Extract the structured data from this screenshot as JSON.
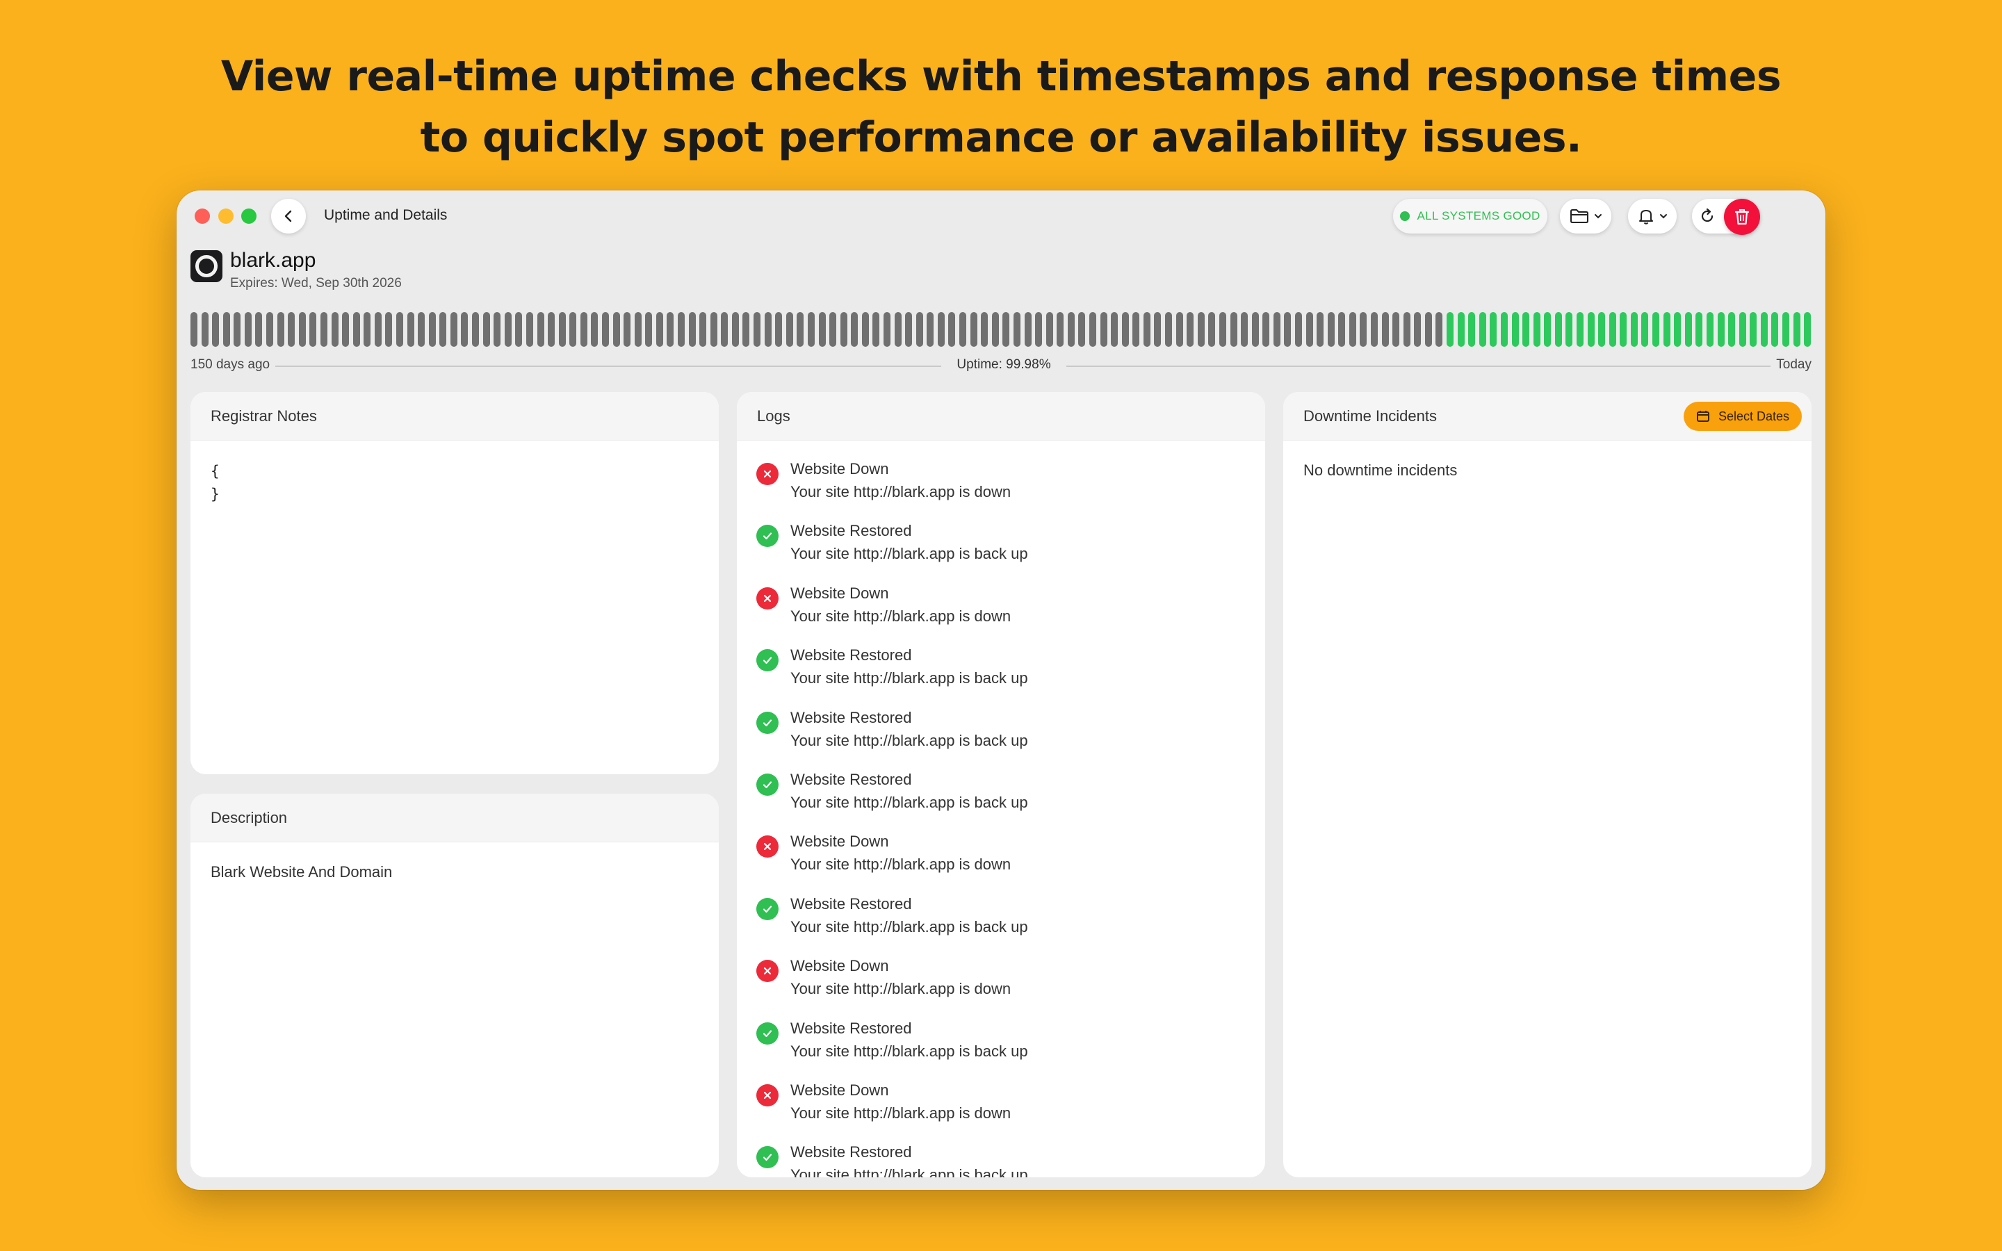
{
  "headline": {
    "line1": "View real-time uptime checks with timestamps and response times",
    "line2": "to quickly spot performance or availability issues."
  },
  "window": {
    "title": "Uptime and Details",
    "status": "ALL SYSTEMS GOOD",
    "colors": {
      "status_green": "#2fbf52",
      "danger_red": "#f3113c",
      "accent_orange": "#f9a10d",
      "bar_down": "#707070",
      "bar_up": "#2ec95c"
    }
  },
  "toolbar": {
    "icons": [
      "chevron-left-icon",
      "folder-icon",
      "bell-icon",
      "refresh-icon",
      "edit-icon",
      "trash-icon"
    ]
  },
  "site": {
    "name": "blark.app",
    "expires": "Expires: Wed, Sep 30th 2026"
  },
  "uptime_bar": {
    "total_bars": 150,
    "green_from_index": 116,
    "left_label": "150 days ago",
    "center_label": "Uptime:  99.98%",
    "right_label": "Today"
  },
  "notes": {
    "title": "Registrar Notes",
    "line1": "{",
    "line2": "}"
  },
  "description": {
    "title": "Description",
    "text": "Blark Website And Domain"
  },
  "logs": {
    "title": "Logs",
    "items": [
      {
        "type": "down",
        "title": "Website Down",
        "message": "Your site http://blark.app is down"
      },
      {
        "type": "up",
        "title": "Website Restored",
        "message": "Your site http://blark.app is back up"
      },
      {
        "type": "down",
        "title": "Website Down",
        "message": "Your site http://blark.app is down"
      },
      {
        "type": "up",
        "title": "Website Restored",
        "message": "Your site http://blark.app is back up"
      },
      {
        "type": "up",
        "title": "Website Restored",
        "message": "Your site http://blark.app is back up"
      },
      {
        "type": "up",
        "title": "Website Restored",
        "message": "Your site http://blark.app is back up"
      },
      {
        "type": "down",
        "title": "Website Down",
        "message": "Your site http://blark.app is down"
      },
      {
        "type": "up",
        "title": "Website Restored",
        "message": "Your site http://blark.app is back up"
      },
      {
        "type": "down",
        "title": "Website Down",
        "message": "Your site http://blark.app is down"
      },
      {
        "type": "up",
        "title": "Website Restored",
        "message": "Your site http://blark.app is back up"
      },
      {
        "type": "down",
        "title": "Website Down",
        "message": "Your site http://blark.app is down"
      },
      {
        "type": "up",
        "title": "Website Restored",
        "message": "Your site http://blark.app is back up"
      }
    ]
  },
  "incidents": {
    "title": "Downtime Incidents",
    "select_dates_label": "Select Dates",
    "empty_text": "No downtime incidents"
  }
}
